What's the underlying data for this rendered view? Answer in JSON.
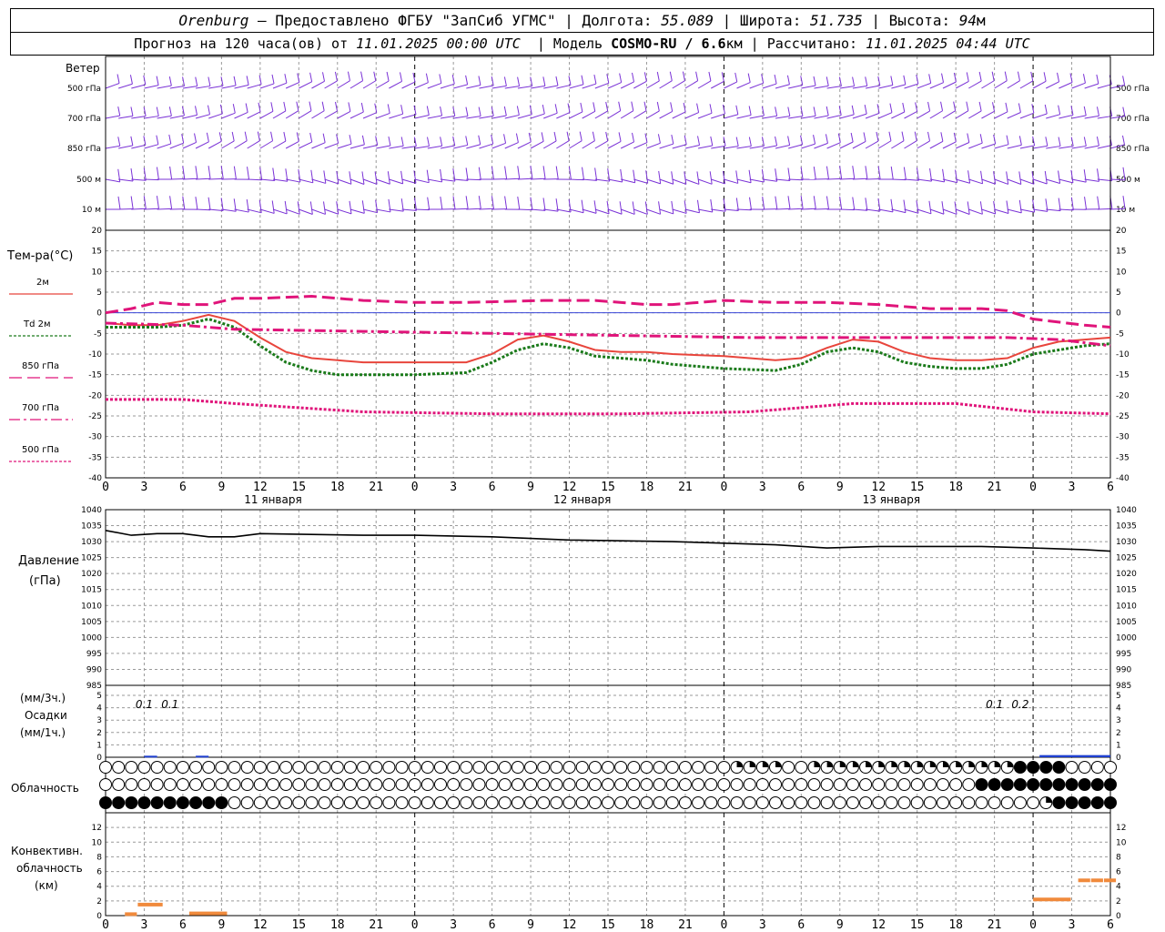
{
  "header": {
    "station": "Orenburg",
    "dash": "—",
    "provider": "Предоставлено ФГБУ \"ЗапСиб УГМС\"",
    "lon_label": "Долгота:",
    "lon": "55.089",
    "lat_label": "Широта:",
    "lat": "51.735",
    "alt_label": "Высота:",
    "alt": "94",
    "alt_unit": "м",
    "forecast_label": "Прогноз на 120 часа(ов) от",
    "forecast_start": "11.01.2025 00:00 UTC",
    "model_label": "Модель",
    "model": "COSMO-RU / 6.6",
    "model_unit": "км",
    "computed_label": "Рассчитано:",
    "computed": "11.01.2025 04:44 UTC"
  },
  "wind": {
    "title": "Ветер",
    "levels": [
      "500 гПа",
      "700 гПа",
      "850 гПа",
      "500 м",
      "10 м"
    ]
  },
  "temperature": {
    "title": "Тем-ра(°C)",
    "legend": [
      {
        "label": "2м",
        "color": "#e8453c",
        "style": "solid"
      },
      {
        "label": "Td 2м",
        "color": "#1a7a1a",
        "style": "dotted"
      },
      {
        "label": "850 гПа",
        "color": "#e0147a",
        "style": "dashed"
      },
      {
        "label": "700 гПа",
        "color": "#e0147a",
        "style": "dashdot"
      },
      {
        "label": "500 гПа",
        "color": "#e0147a",
        "style": "dotted"
      }
    ]
  },
  "pressure": {
    "title": "Давление",
    "unit": "(гПа)"
  },
  "precip": {
    "unit3": "(мм/3ч.)",
    "title": "Осадки",
    "unit1": "(мм/1ч.)",
    "labels": [
      {
        "x": 4.5,
        "text": "0.1"
      },
      {
        "x": 7.5,
        "text": "0.1"
      },
      {
        "x": 103.5,
        "text": "0.1"
      },
      {
        "x": 106.5,
        "text": "0.2"
      }
    ]
  },
  "cloud": {
    "title": "Облачность"
  },
  "convective": {
    "title1": "Конвективн.",
    "title2": "облачность",
    "unit": "(км)"
  },
  "time_axis": {
    "ticks": [
      "0",
      "3",
      "6",
      "9",
      "12",
      "15",
      "18",
      "21",
      "0",
      "3",
      "6",
      "9",
      "12",
      "15",
      "18",
      "21",
      "0",
      "3",
      "6",
      "9",
      "12",
      "15",
      "18",
      "21",
      "0",
      "3",
      "6"
    ],
    "days": [
      {
        "x": 13,
        "label": "11 января"
      },
      {
        "x": 37,
        "label": "12 января"
      },
      {
        "x": 61,
        "label": "13 января"
      }
    ]
  },
  "chart_data": [
    {
      "type": "line",
      "title": "Тем-ра(°C)",
      "x_unit": "hours from 11.01.2025 00:00 UTC",
      "ylim": [
        -40,
        20
      ],
      "yticks": [
        20,
        15,
        10,
        5,
        0,
        -5,
        -10,
        -15,
        -20,
        -25,
        -30,
        -35,
        -40
      ],
      "series": [
        {
          "name": "2м",
          "color": "#e8453c",
          "x": [
            0,
            2,
            4,
            6,
            8,
            10,
            12,
            14,
            16,
            18,
            20,
            24,
            28,
            30,
            32,
            34,
            36,
            38,
            40,
            42,
            44,
            48,
            52,
            54,
            56,
            58,
            60,
            62,
            64,
            66,
            68,
            70,
            72,
            74,
            76,
            78
          ],
          "values": [
            -2.5,
            -3,
            -3,
            -2,
            -0.5,
            -2,
            -6,
            -9.5,
            -11,
            -11.5,
            -12,
            -12,
            -12,
            -10,
            -6.5,
            -5.5,
            -7,
            -9,
            -9.5,
            -9.5,
            -10,
            -10.5,
            -11.5,
            -11,
            -8.5,
            -6.5,
            -7,
            -9.5,
            -11,
            -11.5,
            -11.5,
            -11,
            -8.5,
            -7,
            -6.5,
            -6
          ]
        },
        {
          "name": "Td 2м",
          "color": "#1a7a1a",
          "x": [
            0,
            2,
            4,
            6,
            8,
            10,
            12,
            14,
            16,
            18,
            20,
            24,
            28,
            30,
            32,
            34,
            36,
            38,
            40,
            42,
            44,
            48,
            52,
            54,
            56,
            58,
            60,
            62,
            64,
            66,
            68,
            70,
            72,
            74,
            76,
            78
          ],
          "values": [
            -3.5,
            -3.5,
            -3.5,
            -3,
            -1.5,
            -3.5,
            -8,
            -12,
            -14,
            -15,
            -15,
            -15,
            -14.5,
            -12,
            -9,
            -7.5,
            -8.5,
            -10.5,
            -11,
            -11.5,
            -12.5,
            -13.5,
            -14,
            -12.5,
            -9.5,
            -8.5,
            -9.5,
            -12,
            -13,
            -13.5,
            -13.5,
            -12.5,
            -10,
            -9,
            -8,
            -7.5
          ]
        },
        {
          "name": "850 гПа",
          "color": "#e0147a",
          "x": [
            0,
            2,
            4,
            6,
            8,
            10,
            12,
            16,
            20,
            24,
            28,
            34,
            38,
            42,
            44,
            48,
            52,
            56,
            60,
            64,
            68,
            70,
            72,
            76,
            78
          ],
          "values": [
            0,
            1,
            2.5,
            2,
            2,
            3.5,
            3.5,
            4,
            3,
            2.5,
            2.5,
            3,
            3,
            2,
            2,
            3,
            2.5,
            2.5,
            2,
            1,
            1,
            0.5,
            -1.5,
            -3,
            -3.5
          ]
        },
        {
          "name": "700 гПа",
          "color": "#e0147a",
          "x": [
            0,
            6,
            10,
            20,
            30,
            40,
            50,
            60,
            70,
            74,
            78
          ],
          "values": [
            -2.5,
            -3,
            -4,
            -4.5,
            -5,
            -5.5,
            -6,
            -6,
            -6,
            -6.5,
            -8
          ]
        },
        {
          "name": "500 гПа",
          "color": "#e0147a",
          "x": [
            0,
            6,
            10,
            20,
            30,
            40,
            50,
            58,
            66,
            72,
            78
          ],
          "values": [
            -21,
            -21,
            -22,
            -24,
            -24.5,
            -24.5,
            -24,
            -22,
            -22,
            -24,
            -24.5
          ]
        }
      ]
    },
    {
      "type": "line",
      "title": "Давление",
      "ylabel": "(гПа)",
      "ylim": [
        985,
        1040
      ],
      "yticks": [
        1040,
        1035,
        1030,
        1025,
        1020,
        1015,
        1010,
        1005,
        1000,
        995,
        990,
        985
      ],
      "series": [
        {
          "name": "Давление",
          "color": "#000000",
          "x": [
            0,
            2,
            4,
            6,
            8,
            10,
            12,
            20,
            24,
            30,
            36,
            44,
            48,
            52,
            56,
            60,
            64,
            68,
            72,
            76,
            78
          ],
          "values": [
            1033.5,
            1032,
            1032.5,
            1032.5,
            1031.5,
            1031.5,
            1032.5,
            1032,
            1032,
            1031.5,
            1030.5,
            1030,
            1029.5,
            1029,
            1028,
            1028.5,
            1028.5,
            1028.5,
            1028,
            1027.5,
            1027
          ]
        }
      ]
    },
    {
      "type": "bar",
      "title": "Осадки",
      "ylim": [
        0,
        5
      ],
      "yticks": [
        5,
        4,
        3,
        2,
        1,
        0
      ],
      "series": [
        {
          "name": "Осадки",
          "color": "#1f3fd0",
          "bars": [
            {
              "x0": 3,
              "x1": 4,
              "value": 0.05
            },
            {
              "x0": 7,
              "x1": 8,
              "value": 0.05
            },
            {
              "x0": 72.5,
              "x1": 78,
              "value": 0.1
            }
          ]
        }
      ]
    },
    {
      "type": "bar",
      "title": "Конвективн. облачность",
      "ylabel": "(км)",
      "ylim": [
        0,
        14
      ],
      "yticks": [
        12,
        10,
        8,
        6,
        4,
        2,
        0
      ],
      "series": [
        {
          "name": "Конвективн. облачность",
          "color": "#f08a3c",
          "segments": [
            {
              "x0": 1.5,
              "x1": 2.5,
              "value": 0.2
            },
            {
              "x0": 2.5,
              "x1": 4.5,
              "value": 1.5
            },
            {
              "x0": 6.5,
              "x1": 9.5,
              "value": 0.3
            },
            {
              "x0": 72,
              "x1": 75,
              "value": 2.2
            },
            {
              "x0": 75.5,
              "x1": 76.5,
              "value": 4.8
            },
            {
              "x0": 76.5,
              "x1": 77.5,
              "value": 4.8
            },
            {
              "x0": 77.5,
              "x1": 78.5,
              "value": 4.8
            }
          ]
        }
      ]
    },
    {
      "type": "table",
      "title": "Облачность",
      "rows": [
        {
          "name": "upper",
          "fill": "0000000000000000000000000000000000000000000000000cccc00ccccccccccccccccffff"
        },
        {
          "name": "middle",
          "fill": "00000000000000000000000000000000000000000000000000000000000000000000ffffffffffff"
        },
        {
          "name": "lower",
          "fill": "ffffffffff000000000000000000000000000000000000000000000000000000000000000cffffff"
        }
      ]
    }
  ],
  "colors": {
    "wind": "#7a32d6",
    "grid": "#9a9a9a",
    "zero": "#3a46d8"
  }
}
